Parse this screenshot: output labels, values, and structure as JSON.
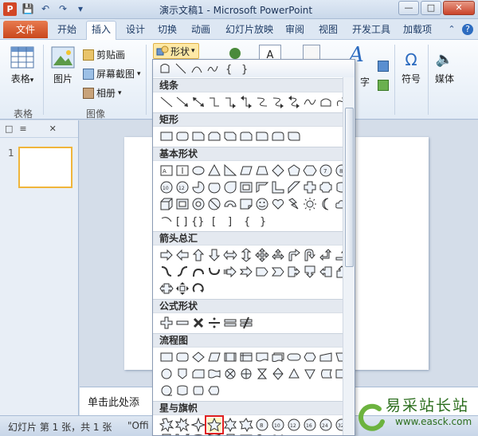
{
  "window": {
    "title": "演示文稿1 - Microsoft PowerPoint",
    "app_badge": "P"
  },
  "tabs": {
    "file": "文件",
    "items": [
      "开始",
      "插入",
      "设计",
      "切换",
      "动画",
      "幻灯片放映",
      "审阅",
      "视图",
      "开发工具",
      "加载项"
    ],
    "active": "插入"
  },
  "ribbon": {
    "tables_group": {
      "label": "表格",
      "button": "表格"
    },
    "images_group": {
      "label": "图像",
      "picture": "图片",
      "clipart": "剪贴画",
      "screenshot": "屏幕截图",
      "album": "相册"
    },
    "shapes_button": "形状",
    "symbols_button": "符号",
    "media_button": "媒体",
    "word_partial": "字"
  },
  "shapes_menu": {
    "categories": [
      "线条",
      "矩形",
      "基本形状",
      "箭头总汇",
      "公式形状",
      "流程图",
      "星与旗帜"
    ]
  },
  "slide_pane": {
    "thumb_number": "1"
  },
  "notes": {
    "placeholder": "单击此处添"
  },
  "status": {
    "slide_info": "幻灯片 第 1 张，共 1 张",
    "theme": "\"Offi"
  },
  "watermark": {
    "title": "易采站长站",
    "url": "www.easck.com"
  },
  "colors": {
    "file_tab": "#c9471d",
    "accent": "#2d6cc0",
    "highlight": "#e02020"
  }
}
